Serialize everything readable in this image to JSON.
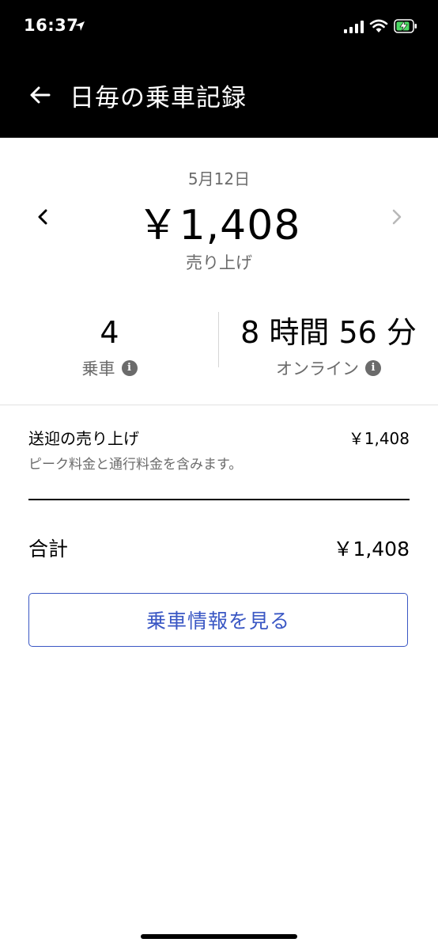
{
  "status_bar": {
    "time": "16:37",
    "icons": [
      "location-arrow-icon",
      "signal-icon",
      "wifi-icon",
      "battery-charging-icon"
    ],
    "battery_color": "#4cd964"
  },
  "nav": {
    "title": "日毎の乗車記録",
    "back_icon": "back-arrow-icon"
  },
  "summary": {
    "date": "5月12日",
    "amount": "￥1,408",
    "caption": "売り上げ",
    "prev_icon": "chevron-left-icon",
    "next_icon": "chevron-right-icon"
  },
  "stats": {
    "rides": {
      "value": "4",
      "label": "乗車"
    },
    "online": {
      "value": "8 時間 56 分",
      "label": "オンライン"
    }
  },
  "breakdown": {
    "title": "送迎の売り上げ",
    "amount": "￥1,408",
    "note": "ピーク料金と通行料金を含みます。"
  },
  "total": {
    "label": "合計",
    "amount": "￥1,408"
  },
  "details_button": {
    "label": "乗車情報を見る",
    "color": "#3a57c4"
  }
}
